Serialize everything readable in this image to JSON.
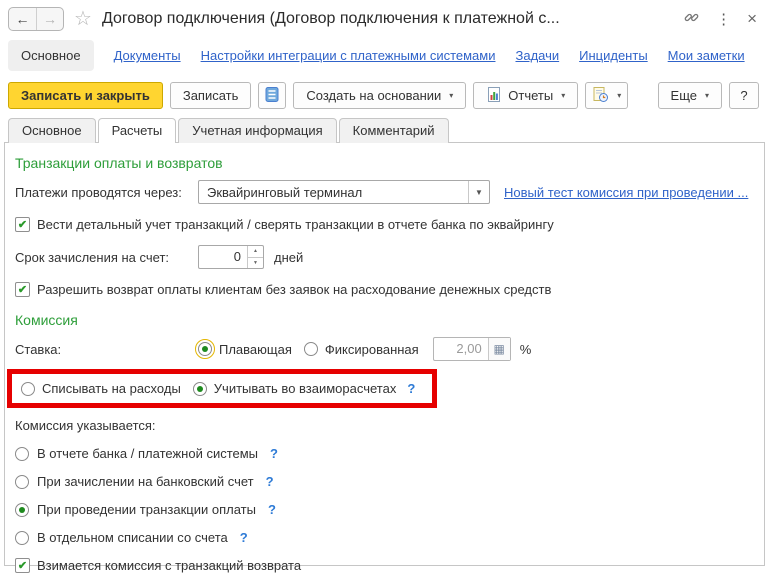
{
  "window": {
    "title": "Договор подключения (Договор подключения к платежной с..."
  },
  "icons": {
    "back": "←",
    "forward": "→",
    "star": "☆",
    "kebab": "⋮",
    "close": "×",
    "caret": "▾",
    "combo_caret": "▼",
    "check": "✔",
    "calc": "▦",
    "spin_up": "▲",
    "spin_down": "▼"
  },
  "nav": {
    "items": [
      {
        "label": "Основное",
        "active": true
      },
      {
        "label": "Документы"
      },
      {
        "label": "Настройки интеграции с платежными системами"
      },
      {
        "label": "Задачи"
      },
      {
        "label": "Инциденты"
      },
      {
        "label": "Мои заметки"
      }
    ]
  },
  "toolbar": {
    "save_close": "Записать и закрыть",
    "save": "Записать",
    "create_based_on": "Создать на основании",
    "reports": "Отчеты",
    "more": "Еще",
    "help": "?"
  },
  "tabs": {
    "items": [
      "Основное",
      "Расчеты",
      "Учетная информация",
      "Комментарий"
    ],
    "active": "Расчеты"
  },
  "form": {
    "section_transactions": "Транзакции оплаты и возвратов",
    "payments_via": {
      "label": "Платежи проводятся через:",
      "value": "Эквайринговый терминал"
    },
    "link_commission": "Новый тест комиссия при проведении ...",
    "checkbox_detailed": {
      "label": "Вести детальный учет транзакций / сверять транзакции в отчете банка по эквайрингу",
      "checked": true
    },
    "term": {
      "label": "Срок зачисления на счет:",
      "value": "0",
      "suffix": "дней"
    },
    "checkbox_refund_no_request": {
      "label": "Разрешить возврат оплаты клиентам без заявок на расходование денежных средств",
      "checked": true
    },
    "section_commission": "Комиссия",
    "rate": {
      "label": "Ставка:",
      "options": [
        {
          "label": "Плавающая",
          "selected": true
        },
        {
          "label": "Фиксированная",
          "selected": false
        }
      ],
      "value": "2,00",
      "percent": "%"
    },
    "writeoff": {
      "options": [
        {
          "label": "Списывать на расходы",
          "selected": false
        },
        {
          "label": "Учитывать во взаиморасчетах",
          "selected": true,
          "help": "?"
        }
      ]
    },
    "specified": {
      "label": "Комиссия указывается:",
      "options": [
        {
          "label": "В отчете банка / платежной системы",
          "selected": false,
          "help": "?"
        },
        {
          "label": "При зачислении на банковский счет",
          "selected": false,
          "help": "?"
        },
        {
          "label": "При проведении транзакции оплаты",
          "selected": true,
          "help": "?"
        },
        {
          "label": "В отдельном списании со счета",
          "selected": false,
          "help": "?"
        }
      ]
    },
    "checkbox_return_commission": {
      "label": "Взимается комиссия с транзакций возврата",
      "checked": true
    }
  },
  "colors": {
    "accent_yellow": "#FFD530",
    "section_green": "#2E9E3A",
    "link_blue": "#3063C9",
    "check_green": "#2B9A2B",
    "annotation_red": "#E60000",
    "help_blue": "#2E7BD6"
  }
}
